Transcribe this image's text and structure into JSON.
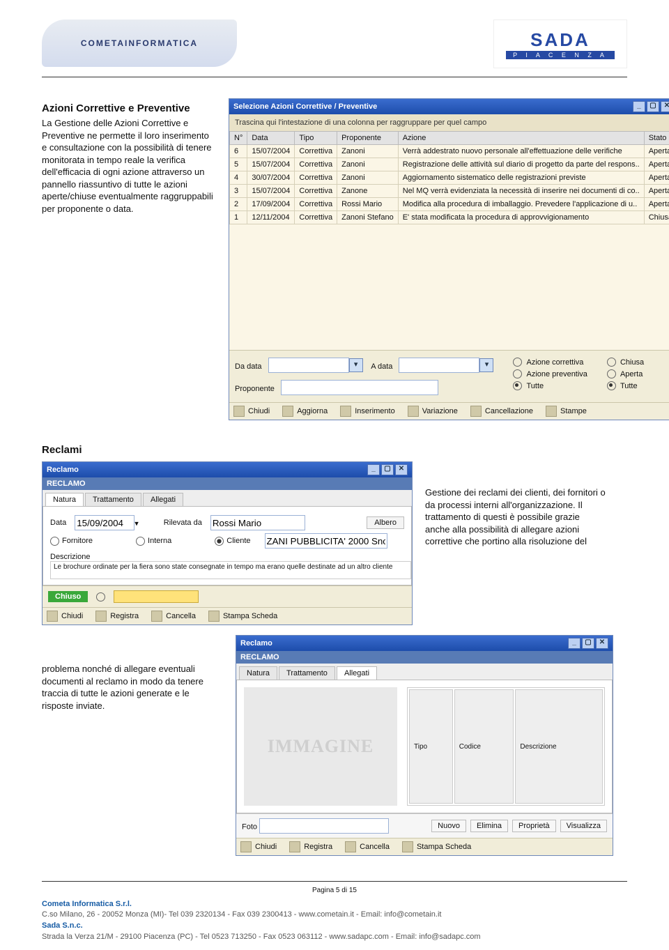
{
  "header": {
    "cometa_logo": "COMETAINFORMATICA",
    "sada_name": "SADA",
    "sada_sub": "P I A C E N Z A"
  },
  "section1": {
    "title": "Azioni Correttive e Preventive",
    "body": "La Gestione delle Azioni Correttive e Preventive ne permette il loro inserimento e consultazione con la possibilità di tenere monitorata in tempo reale la verifica dell'efficacia di ogni azione attraverso un pannello riassuntivo di tutte le azioni aperte/chiuse eventualmente raggruppabili per proponente o data."
  },
  "shot1": {
    "title": "Selezione Azioni Correttive / Preventive",
    "hint": "Trascina qui l'intestazione di una colonna per raggruppare per quel campo",
    "columns": [
      "N°",
      "Data",
      "Tipo",
      "Proponente",
      "Azione",
      "Stato"
    ],
    "rows": [
      {
        "n": "6",
        "data": "15/07/2004",
        "tipo": "Correttiva",
        "prop": "Zanoni",
        "azione": "Verrà addestrato nuovo personale all'effettuazione delle verifiche",
        "stato": "Aperta"
      },
      {
        "n": "5",
        "data": "15/07/2004",
        "tipo": "Correttiva",
        "prop": "Zanoni",
        "azione": "Registrazione delle attività sul diario di progetto da parte del respons..",
        "stato": "Aperta"
      },
      {
        "n": "4",
        "data": "30/07/2004",
        "tipo": "Correttiva",
        "prop": "Zanoni",
        "azione": "Aggiornamento sistematico delle registrazioni previste",
        "stato": "Aperta"
      },
      {
        "n": "3",
        "data": "15/07/2004",
        "tipo": "Correttiva",
        "prop": "Zanone",
        "azione": "Nel MQ verrà evidenziata la necessità di inserire nei documenti di co..",
        "stato": "Aperta"
      },
      {
        "n": "2",
        "data": "17/09/2004",
        "tipo": "Correttiva",
        "prop": "Rossi Mario",
        "azione": "Modifica alla procedura di imballaggio. Prevedere l'applicazione di u..",
        "stato": "Aperta"
      },
      {
        "n": "1",
        "data": "12/11/2004",
        "tipo": "Correttiva",
        "prop": "Zanoni Stefano",
        "azione": "E' stata modificata la procedura di approvvigionamento",
        "stato": "Chiusa"
      }
    ],
    "filters": {
      "da_data_label": "Da data",
      "a_data_label": "A data",
      "proponente_label": "Proponente",
      "radio_type": [
        "Azione correttiva",
        "Azione preventiva",
        "Tutte"
      ],
      "radio_state": [
        "Chiusa",
        "Aperta",
        "Tutte"
      ]
    },
    "toolbar": [
      "Chiudi",
      "Aggiorna",
      "Inserimento",
      "Variazione",
      "Cancellazione",
      "Stampe"
    ]
  },
  "section2": {
    "title": "Reclami"
  },
  "shot2": {
    "title": "Reclamo",
    "header": "RECLAMO",
    "tabs": [
      "Natura",
      "Trattamento",
      "Allegati"
    ],
    "data_label": "Data",
    "data_val": "15/09/2004",
    "rilevata_label": "Rilevata da",
    "rilevata_val": "Rossi Mario",
    "albero_btn": "Albero",
    "cliente_val": "ZANI PUBBLICITA' 2000 Snc",
    "radio": [
      "Fornitore",
      "Interna",
      "Cliente"
    ],
    "desc_label": "Descrizione",
    "desc_val": "Le brochure ordinate per la fiera sono state consegnate in tempo ma erano quelle destinate ad un altro cliente",
    "status": "Chiuso",
    "toolbar": [
      "Chiudi",
      "Registra",
      "Cancella",
      "Stampa Scheda"
    ]
  },
  "para2": "Gestione dei reclami dei clienti, dei fornitori o da processi interni all'organizzazione. Il trattamento di questi è possibile grazie anche alla possibilità di allegare azioni correttive che portino alla risoluzione del",
  "para3": "problema nonché di allegare eventuali documenti al reclamo in modo da tenere traccia di tutte le azioni generate e le risposte inviate.",
  "shot3": {
    "title": "Reclamo",
    "header": "RECLAMO",
    "tabs": [
      "Natura",
      "Trattamento",
      "Allegati"
    ],
    "placeholder": "IMMAGINE",
    "att_cols": [
      "Tipo",
      "Codice",
      "Descrizione"
    ],
    "foto_label": "Foto",
    "buttons": [
      "Nuovo",
      "Elimina",
      "Proprietà",
      "Visualizza"
    ],
    "toolbar": [
      "Chiudi",
      "Registra",
      "Cancella",
      "Stampa Scheda"
    ]
  },
  "footer": {
    "page": "Pagina 5 di 15",
    "line1_name": "Cometa Informatica S.r.l.",
    "line1_addr": "C.so Milano, 26 - 20052 Monza (MI)- Tel 039 2320134 - Fax 039 2300413 - www.cometain.it - Email: info@cometain.it",
    "line2_name": "Sada S.n.c.",
    "line2_addr": "Strada la Verza 21/M - 29100 Piacenza (PC) - Tel 0523 713250 - Fax 0523 063112 - www.sadapc.com - Email: info@sadapc.com"
  }
}
